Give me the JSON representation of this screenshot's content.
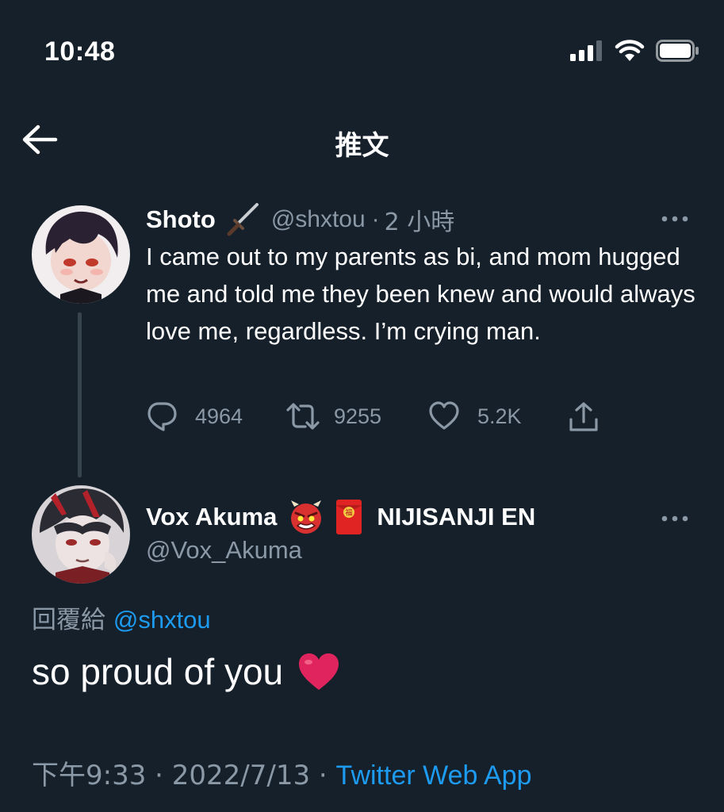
{
  "status_bar": {
    "time": "10:48"
  },
  "header": {
    "title": "推文"
  },
  "original_tweet": {
    "display_name": "Shoto",
    "name_emoji": "dagger-icon",
    "handle": "@shxtou",
    "separator": "·",
    "time_ago": "2 小時",
    "text": "I came out to my parents as bi, and mom hugged me and told me they been knew and would always love me, regardless. I’m crying man.",
    "replies": "4964",
    "retweets": "9255",
    "likes": "5.2K"
  },
  "reply_tweet": {
    "display_name": "Vox Akuma",
    "name_suffix": "NIJISANJI EN",
    "name_emojis": [
      "ogre-icon",
      "red-envelope-icon"
    ],
    "handle": "@Vox_Akuma",
    "replying_label": "回覆給",
    "replying_to": "@shxtou",
    "text": "so proud of you",
    "text_emoji": "red-heart-icon",
    "timestamp": "下午9:33 · 2022/7/13 ·",
    "source": "Twitter Web App"
  },
  "colors": {
    "background": "#15202b",
    "text_primary": "#ffffff",
    "text_secondary": "#8b98a5",
    "accent": "#1d9bf0",
    "heart": "#e0245e"
  }
}
